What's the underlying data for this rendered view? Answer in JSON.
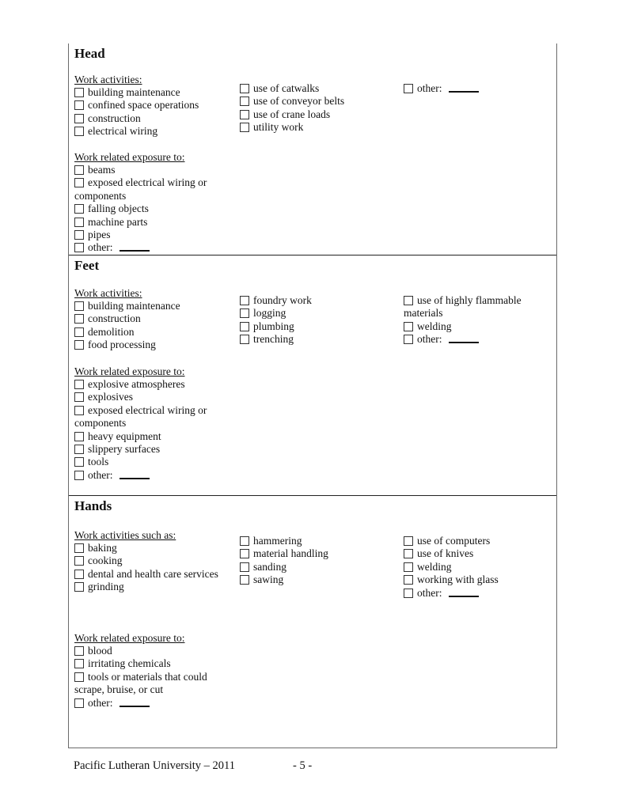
{
  "sections": {
    "head": {
      "title": "Head",
      "activities_label": "Work activities:",
      "activities_col1": [
        "building maintenance",
        "confined space operations",
        "construction",
        "electrical wiring"
      ],
      "activities_col2": [
        "use of catwalks",
        "use of conveyor belts",
        "use of crane loads",
        "utility work"
      ],
      "activities_col3": [
        "other:"
      ],
      "exposure_label": "Work related exposure to:",
      "exposure": [
        "beams",
        "exposed electrical wiring or components",
        "falling objects",
        "machine parts",
        "pipes",
        "other:"
      ]
    },
    "feet": {
      "title": "Feet",
      "activities_label": "Work activities:",
      "activities_col1": [
        "building maintenance",
        "construction",
        "demolition",
        "food processing"
      ],
      "activities_col2": [
        "foundry work",
        "logging",
        "plumbing",
        "trenching"
      ],
      "activities_col3": [
        "use of highly flammable materials",
        "welding",
        "other:"
      ],
      "exposure_label": "Work related exposure to:",
      "exposure": [
        "explosive atmospheres",
        "explosives",
        "exposed electrical wiring or components",
        "heavy equipment",
        "slippery surfaces",
        "tools",
        "other:"
      ]
    },
    "hands": {
      "title": "Hands",
      "activities_label": "Work activities such as:",
      "activities_col1": [
        "baking",
        "cooking",
        "dental and health care services",
        "grinding"
      ],
      "activities_col2": [
        "hammering",
        "material handling",
        "sanding",
        "sawing"
      ],
      "activities_col3": [
        "use of computers",
        "use of knives",
        "welding",
        "working with glass",
        "other:"
      ],
      "exposure_label": "Work related exposure to:",
      "exposure": [
        "blood",
        "irritating chemicals",
        "tools or materials that could scrape, bruise, or cut",
        "other:"
      ]
    }
  },
  "footer": {
    "org": "Pacific Lutheran University – 2011",
    "page": "- 5 -"
  }
}
